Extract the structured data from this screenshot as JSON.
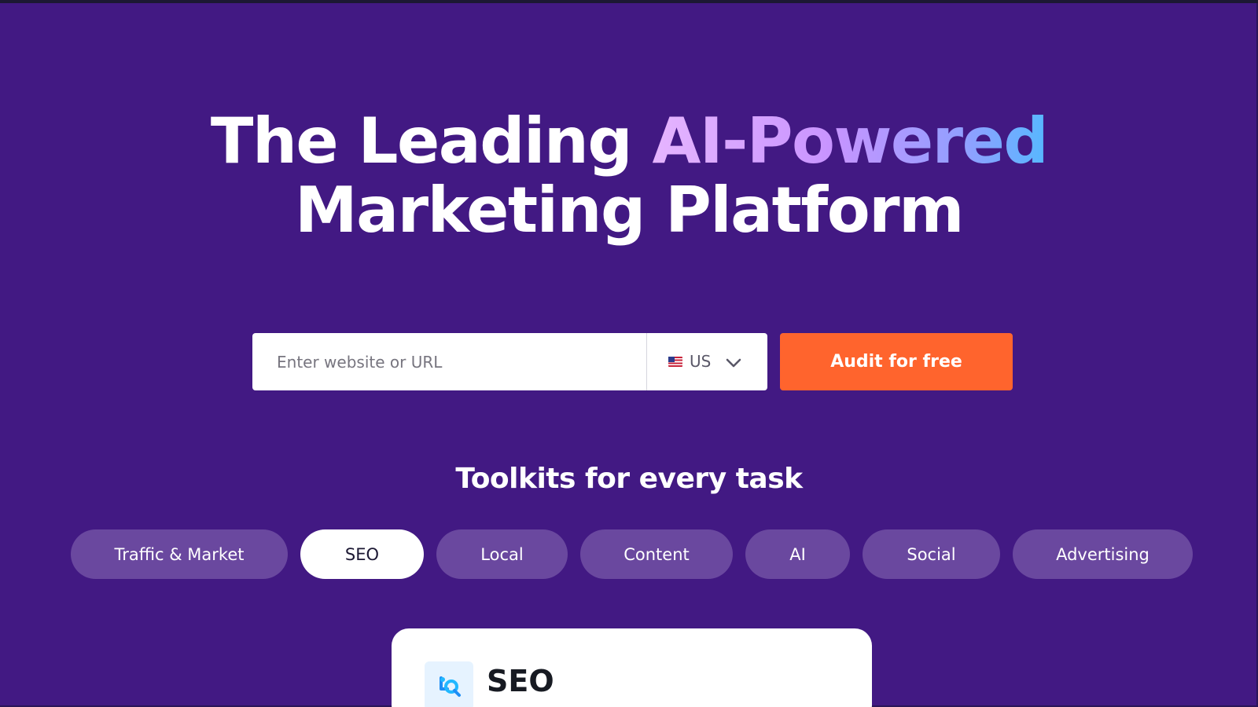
{
  "hero": {
    "title_part1": "The Leading ",
    "title_highlight": "AI-Powered",
    "title_line2": "Marketing Platform"
  },
  "search": {
    "placeholder": "Enter website or URL",
    "country": "US",
    "flag_icon": "us-flag-icon",
    "submit_label": "Audit for free"
  },
  "toolkits": {
    "heading": "Toolkits for every task",
    "tabs": [
      {
        "label": "Traffic & Market",
        "active": false
      },
      {
        "label": "SEO",
        "active": true
      },
      {
        "label": "Local",
        "active": false
      },
      {
        "label": "Content",
        "active": false
      },
      {
        "label": "AI",
        "active": false
      },
      {
        "label": "Social",
        "active": false
      },
      {
        "label": "Advertising",
        "active": false
      }
    ]
  },
  "card": {
    "title": "SEO",
    "icon": "seo-icon"
  },
  "colors": {
    "background": "#421983",
    "accent_orange": "#ff642d",
    "tab_inactive": "#6a489f",
    "tab_active": "#ffffff",
    "gradient": [
      "#e6b5ff",
      "#c894ff",
      "#8fa0ff",
      "#56b8ff"
    ]
  }
}
